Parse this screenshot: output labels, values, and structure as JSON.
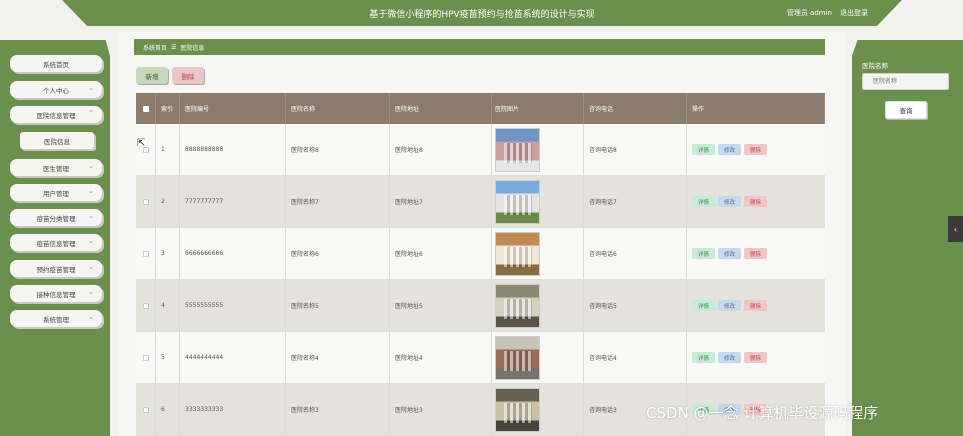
{
  "header": {
    "title": "基于微信小程序的HPV疫苗预约与抢苗系统的设计与实现",
    "user": "管理员 admin",
    "logout": "退出登录"
  },
  "sidebar": {
    "items": [
      {
        "label": "系统首页"
      },
      {
        "label": "个人中心"
      },
      {
        "label": "医院信息管理"
      },
      {
        "label": "医院信息"
      },
      {
        "label": "医生管理"
      },
      {
        "label": "用户管理"
      },
      {
        "label": "疫苗分类管理"
      },
      {
        "label": "疫苗信息管理"
      },
      {
        "label": "预约疫苗管理"
      },
      {
        "label": "接种信息管理"
      },
      {
        "label": "系统管理"
      }
    ]
  },
  "breadcrumb": {
    "home": "系统首页",
    "sep": "☰",
    "current": "医院信息"
  },
  "toolbar": {
    "add": "新增",
    "delete": "删除"
  },
  "search": {
    "label": "医院名称",
    "placeholder": "医院名称",
    "button": "查询"
  },
  "table": {
    "headers": [
      "索引",
      "医院编号",
      "医院名称",
      "医院地址",
      "医院图片",
      "咨询电话",
      "操作"
    ],
    "rows": [
      {
        "idx": "1",
        "code": "8888888888",
        "name": "医院名称8",
        "addr": "医院地址8",
        "phone": "咨询电话8"
      },
      {
        "idx": "2",
        "code": "7777777777",
        "name": "医院名称7",
        "addr": "医院地址7",
        "phone": "咨询电话7"
      },
      {
        "idx": "3",
        "code": "6666666666",
        "name": "医院名称6",
        "addr": "医院地址6",
        "phone": "咨询电话6"
      },
      {
        "idx": "4",
        "code": "5555555555",
        "name": "医院名称5",
        "addr": "医院地址5",
        "phone": "咨询电话5"
      },
      {
        "idx": "5",
        "code": "4444444444",
        "name": "医院名称4",
        "addr": "医院地址4",
        "phone": "咨询电话4"
      },
      {
        "idx": "6",
        "code": "3333333333",
        "name": "医院名称3",
        "addr": "医院地址3",
        "phone": "咨询电话3"
      }
    ],
    "actions": {
      "detail": "详情",
      "edit": "修改",
      "del": "删除"
    }
  },
  "watermark": "CSDN @一念 计算机毕设源码程序",
  "colors": {
    "primary": "#6b8f4c",
    "table_header": "#8a7b6c"
  }
}
